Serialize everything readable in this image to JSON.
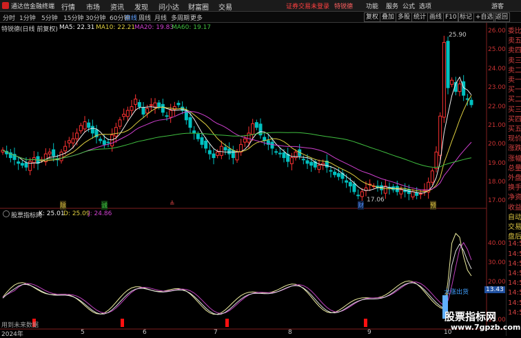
{
  "app": {
    "name": "通达信金融终端",
    "menus": [
      "行情",
      "市场",
      "资讯",
      "发现",
      "问小达",
      "财富圈",
      "交易"
    ],
    "notice": "证券交易未登录",
    "stock_link": "特锐德",
    "right_menus": [
      "功能",
      "服务",
      "公式",
      "选项"
    ],
    "guest": "游客"
  },
  "periods": [
    "分时",
    "1分钟",
    "5分钟",
    "15分钟",
    "30分钟",
    "60分钟",
    "日线",
    "周线",
    "月线",
    "多周期",
    "更多"
  ],
  "active_period": "日线",
  "toolbar": [
    "复权",
    "叠加",
    "多股",
    "统计",
    "画线",
    "F10",
    "标记",
    "+自选",
    "返回"
  ],
  "main": {
    "title": "特锐德(日线 前复权)",
    "ma5": "MA5: 22.31",
    "ma10": "MA10: 22.21",
    "ma20": "MA20: 19.83",
    "ma60": "MA60: 19.17",
    "y_ticks": [
      "26.00",
      "25.00",
      "24.00",
      "23.00",
      "22.00",
      "21.00",
      "20.00",
      "19.00",
      "18.00",
      "17.00"
    ],
    "high_label": "25.90",
    "low_label": "17.06",
    "markers": [
      {
        "text": "除",
        "color": "#d8c040"
      },
      {
        "text": "诚",
        "color": "#40c040"
      },
      {
        "text": "≜",
        "color": "#d04040"
      },
      {
        "text": "财",
        "color": "#5090ff"
      },
      {
        "text": "预",
        "color": "#d8c040"
      }
    ]
  },
  "indicator": {
    "title": "股票指标网",
    "k": "K: 25.01",
    "d": "D: 25.09",
    "j": "J: 24.86",
    "y_ticks": [
      "40.00",
      "30.00",
      "20.00",
      "10.00"
    ],
    "current": "13.43",
    "signal_label": "大涨出货",
    "footer_note": "用到未来数据"
  },
  "x_axis": [
    "2024年",
    "5",
    "6",
    "7",
    "8",
    "9",
    "10"
  ],
  "right_panel": [
    "委比",
    "卖五",
    "卖四",
    "卖三",
    "卖二",
    "卖一",
    "买一",
    "买二",
    "买三",
    "买四",
    "买五",
    "现价",
    "涨跌",
    "涨幅",
    "总量",
    "外盘",
    "换手",
    "净资",
    "收益",
    "自动",
    "交易",
    "盘后",
    "14:5",
    "14:5",
    "14:5",
    "14:5",
    "14:5",
    "14:5",
    "14:5",
    "14:5"
  ],
  "watermark": {
    "title": "股票指标网",
    "url": "www.7gpzb.com"
  },
  "colors": {
    "up": "#ff3232",
    "down": "#00c0c0",
    "ma5": "#f0f0f0",
    "ma10": "#e0d040",
    "ma20": "#d040d0",
    "ma60": "#40c040"
  }
}
